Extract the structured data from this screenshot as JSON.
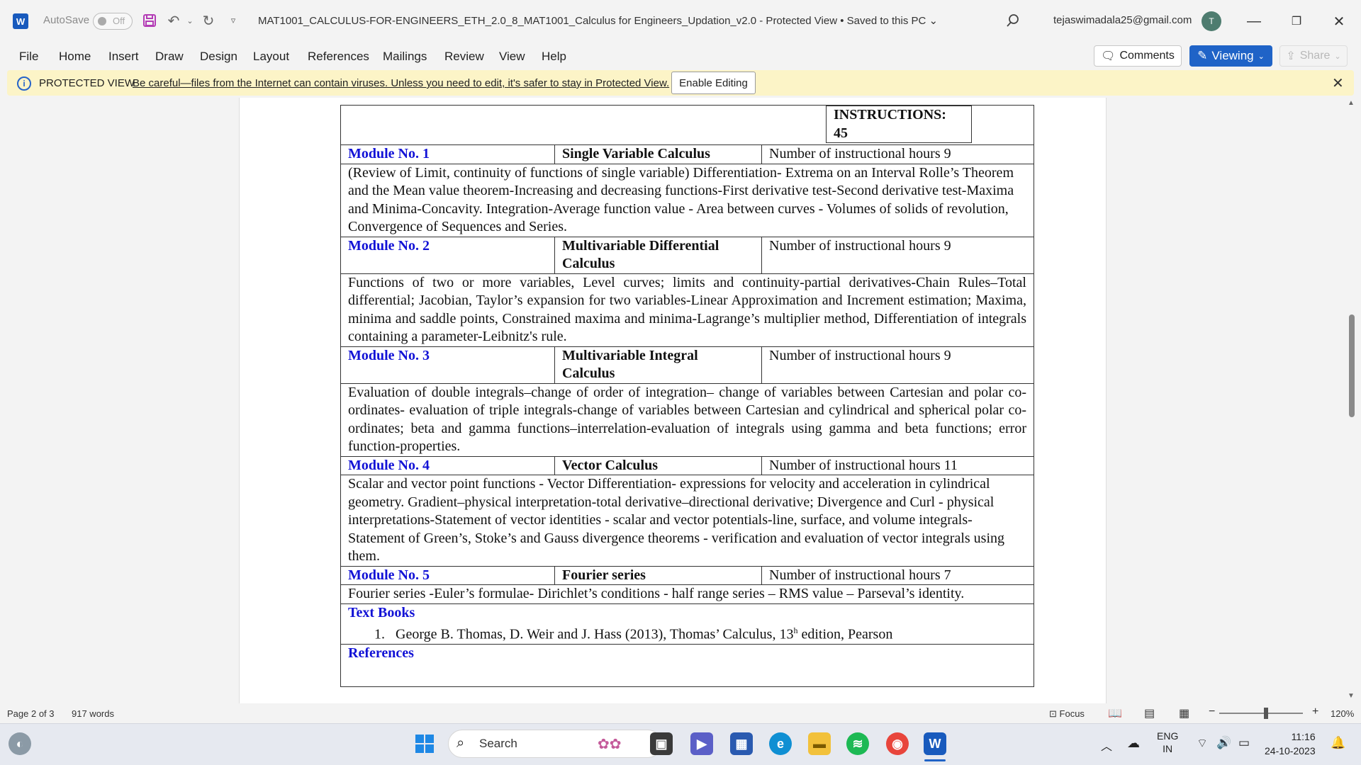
{
  "titlebar": {
    "autosave_label": "AutoSave",
    "autosave_state": "Off",
    "document_title": "MAT1001_CALCULUS-FOR-ENGINEERS_ETH_2.0_8_MAT1001_Calculus for Engineers_Updation_v2.0  -  Protected View • Saved to this PC",
    "user_email": "tejaswimadala25@gmail.com",
    "avatar_initial": "T"
  },
  "menu": {
    "items": [
      "File",
      "Home",
      "Insert",
      "Draw",
      "Design",
      "Layout",
      "References",
      "Mailings",
      "Review",
      "View",
      "Help"
    ],
    "comments_label": "Comments",
    "viewing_label": "Viewing",
    "share_label": "Share"
  },
  "protected_view": {
    "title": "PROTECTED VIEW",
    "message": "Be careful—files from the Internet can contain viruses. Unless you need to edit, it's safer to stay in Protected View.",
    "enable_label": "Enable Editing"
  },
  "document": {
    "instructions_label": "INSTRUCTIONS:",
    "instructions_value": "45",
    "modules": [
      {
        "number": "Module No. 1",
        "title": "Single Variable Calculus",
        "hours": "Number of instructional hours 9",
        "content": "(Review of Limit, continuity of functions of single variable) Differentiation- Extrema on an Interval Rolle’s Theorem and the Mean value theorem-Increasing and decreasing functions-First derivative test-Second derivative test-Maxima and Minima-Concavity. Integration-Average function value - Area between curves - Volumes of solids of revolution, Convergence of Sequences and Series."
      },
      {
        "number": "Module No. 2",
        "title": "Multivariable Differential Calculus",
        "hours": "Number of instructional hours 9",
        "content": "Functions of two or more variables, Level curves; limits and continuity-partial derivatives-Chain Rules–Total differential; Jacobian, Taylor’s expansion for two variables-Linear Approximation and Increment estimation; Maxima, minima and saddle points, Constrained maxima and minima-Lagrange’s multiplier method, Differentiation of integrals containing a parameter-Leibnitz's rule."
      },
      {
        "number": "Module No. 3",
        "title": "Multivariable Integral Calculus",
        "hours": "Number of instructional hours 9",
        "content": "Evaluation of double integrals–change of order of integration– change of variables between Cartesian and polar co-ordinates- evaluation of triple integrals-change of variables between Cartesian and cylindrical and spherical polar co-ordinates; beta and gamma functions–interrelation-evaluation of integrals using gamma and beta functions; error function-properties."
      },
      {
        "number": "Module No. 4",
        "title": "Vector Calculus",
        "hours": "Number of instructional hours 11",
        "content": "Scalar and vector point functions - Vector Differentiation- expressions for velocity and acceleration in cylindrical geometry. Gradient–physical interpretation-total derivative–directional derivative; Divergence and Curl - physical interpretations-Statement of vector identities - scalar and vector potentials-line, surface, and volume integrals- Statement of Green’s, Stoke’s and Gauss divergence theorems - verification and evaluation of vector integrals using them."
      },
      {
        "number": "Module No. 5",
        "title": "Fourier series",
        "hours": "Number of instructional hours 7",
        "content": "Fourier series -Euler’s formulae- Dirichlet’s conditions - half range series – RMS value – Parseval’s identity."
      }
    ],
    "textbooks_heading": "Text Books",
    "textbook_number": "1.",
    "textbook_1": "George B. Thomas, D. Weir and J. Hass (2013), Thomas’ Calculus, 13",
    "textbook_1_sup": "h",
    "textbook_1_end": " edition, Pearson",
    "references_heading": "References"
  },
  "statusbar": {
    "page": "Page 2 of 3",
    "words": "917 words",
    "focus": "Focus",
    "zoom": "120%"
  },
  "taskbar": {
    "search_placeholder": "Search",
    "lang_top": "ENG",
    "lang_bottom": "IN",
    "time": "11:16",
    "date": "24-10-2023"
  },
  "colors": {
    "word_blue": "#185abd",
    "viewing_blue": "#1f63c7",
    "protected_bg": "#fcf4c7",
    "module_heading": "#1212d6"
  }
}
